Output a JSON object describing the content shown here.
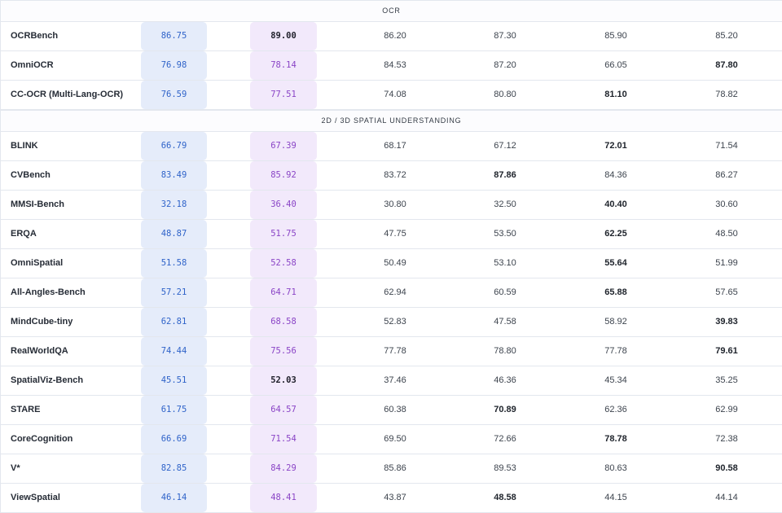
{
  "sections": [
    {
      "title": "OCR",
      "rows": [
        {
          "name": "OCRBench",
          "a": "86.75",
          "b": "89.00",
          "c1": "86.20",
          "c2": "87.30",
          "c3": "85.90",
          "c4": "85.20",
          "best": "b"
        },
        {
          "name": "OmniOCR",
          "a": "76.98",
          "b": "78.14",
          "c1": "84.53",
          "c2": "87.20",
          "c3": "66.05",
          "c4": "87.80",
          "best": "c4"
        },
        {
          "name": "CC-OCR (Multi-Lang-OCR)",
          "a": "76.59",
          "b": "77.51",
          "c1": "74.08",
          "c2": "80.80",
          "c3": "81.10",
          "c4": "78.82",
          "best": "c3"
        }
      ]
    },
    {
      "title": "2D / 3D SPATIAL UNDERSTANDING",
      "rows": [
        {
          "name": "BLINK",
          "a": "66.79",
          "b": "67.39",
          "c1": "68.17",
          "c2": "67.12",
          "c3": "72.01",
          "c4": "71.54",
          "best": "c3"
        },
        {
          "name": "CVBench",
          "a": "83.49",
          "b": "85.92",
          "c1": "83.72",
          "c2": "87.86",
          "c3": "84.36",
          "c4": "86.27",
          "best": "c2"
        },
        {
          "name": "MMSI-Bench",
          "a": "32.18",
          "b": "36.40",
          "c1": "30.80",
          "c2": "32.50",
          "c3": "40.40",
          "c4": "30.60",
          "best": "c3"
        },
        {
          "name": "ERQA",
          "a": "48.87",
          "b": "51.75",
          "c1": "47.75",
          "c2": "53.50",
          "c3": "62.25",
          "c4": "48.50",
          "best": "c3"
        },
        {
          "name": "OmniSpatial",
          "a": "51.58",
          "b": "52.58",
          "c1": "50.49",
          "c2": "53.10",
          "c3": "55.64",
          "c4": "51.99",
          "best": "c3"
        },
        {
          "name": "All-Angles-Bench",
          "a": "57.21",
          "b": "64.71",
          "c1": "62.94",
          "c2": "60.59",
          "c3": "65.88",
          "c4": "57.65",
          "best": "c3"
        },
        {
          "name": "MindCube-tiny",
          "a": "62.81",
          "b": "68.58",
          "c1": "52.83",
          "c2": "47.58",
          "c3": "58.92",
          "c4": "39.83",
          "best": "c4"
        },
        {
          "name": "RealWorldQA",
          "a": "74.44",
          "b": "75.56",
          "c1": "77.78",
          "c2": "78.80",
          "c3": "77.78",
          "c4": "79.61",
          "best": "c4"
        },
        {
          "name": "SpatialViz-Bench",
          "a": "45.51",
          "b": "52.03",
          "c1": "37.46",
          "c2": "46.36",
          "c3": "45.34",
          "c4": "35.25",
          "best": "b"
        },
        {
          "name": "STARE",
          "a": "61.75",
          "b": "64.57",
          "c1": "60.38",
          "c2": "70.89",
          "c3": "62.36",
          "c4": "62.99",
          "best": "c2"
        },
        {
          "name": "CoreCognition",
          "a": "66.69",
          "b": "71.54",
          "c1": "69.50",
          "c2": "72.66",
          "c3": "78.78",
          "c4": "72.38",
          "best": "c3"
        },
        {
          "name": "V*",
          "a": "82.85",
          "b": "84.29",
          "c1": "85.86",
          "c2": "89.53",
          "c3": "80.63",
          "c4": "90.58",
          "best": "c4"
        },
        {
          "name": "ViewSpatial",
          "a": "46.14",
          "b": "48.41",
          "c1": "43.87",
          "c2": "48.58",
          "c3": "44.15",
          "c4": "44.14",
          "best": "c2"
        }
      ]
    }
  ]
}
